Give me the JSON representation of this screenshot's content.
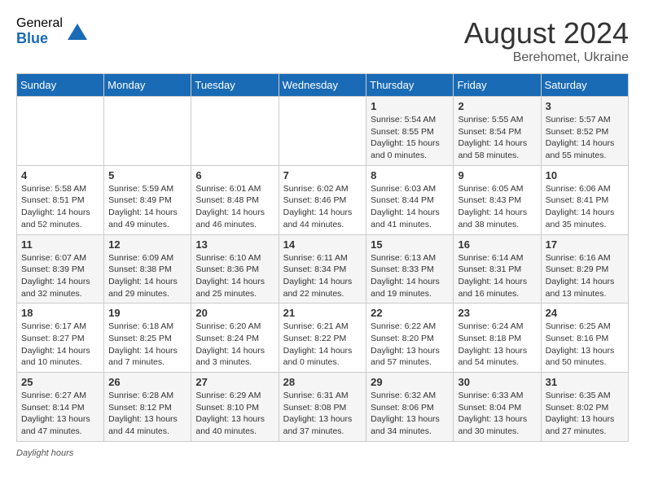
{
  "logo": {
    "general": "General",
    "blue": "Blue"
  },
  "header": {
    "month_year": "August 2024",
    "location": "Berehomet, Ukraine"
  },
  "weekdays": [
    "Sunday",
    "Monday",
    "Tuesday",
    "Wednesday",
    "Thursday",
    "Friday",
    "Saturday"
  ],
  "weeks": [
    [
      {
        "day": "",
        "info": ""
      },
      {
        "day": "",
        "info": ""
      },
      {
        "day": "",
        "info": ""
      },
      {
        "day": "",
        "info": ""
      },
      {
        "day": "1",
        "info": "Sunrise: 5:54 AM\nSunset: 8:55 PM\nDaylight: 15 hours\nand 0 minutes."
      },
      {
        "day": "2",
        "info": "Sunrise: 5:55 AM\nSunset: 8:54 PM\nDaylight: 14 hours\nand 58 minutes."
      },
      {
        "day": "3",
        "info": "Sunrise: 5:57 AM\nSunset: 8:52 PM\nDaylight: 14 hours\nand 55 minutes."
      }
    ],
    [
      {
        "day": "4",
        "info": "Sunrise: 5:58 AM\nSunset: 8:51 PM\nDaylight: 14 hours\nand 52 minutes."
      },
      {
        "day": "5",
        "info": "Sunrise: 5:59 AM\nSunset: 8:49 PM\nDaylight: 14 hours\nand 49 minutes."
      },
      {
        "day": "6",
        "info": "Sunrise: 6:01 AM\nSunset: 8:48 PM\nDaylight: 14 hours\nand 46 minutes."
      },
      {
        "day": "7",
        "info": "Sunrise: 6:02 AM\nSunset: 8:46 PM\nDaylight: 14 hours\nand 44 minutes."
      },
      {
        "day": "8",
        "info": "Sunrise: 6:03 AM\nSunset: 8:44 PM\nDaylight: 14 hours\nand 41 minutes."
      },
      {
        "day": "9",
        "info": "Sunrise: 6:05 AM\nSunset: 8:43 PM\nDaylight: 14 hours\nand 38 minutes."
      },
      {
        "day": "10",
        "info": "Sunrise: 6:06 AM\nSunset: 8:41 PM\nDaylight: 14 hours\nand 35 minutes."
      }
    ],
    [
      {
        "day": "11",
        "info": "Sunrise: 6:07 AM\nSunset: 8:39 PM\nDaylight: 14 hours\nand 32 minutes."
      },
      {
        "day": "12",
        "info": "Sunrise: 6:09 AM\nSunset: 8:38 PM\nDaylight: 14 hours\nand 29 minutes."
      },
      {
        "day": "13",
        "info": "Sunrise: 6:10 AM\nSunset: 8:36 PM\nDaylight: 14 hours\nand 25 minutes."
      },
      {
        "day": "14",
        "info": "Sunrise: 6:11 AM\nSunset: 8:34 PM\nDaylight: 14 hours\nand 22 minutes."
      },
      {
        "day": "15",
        "info": "Sunrise: 6:13 AM\nSunset: 8:33 PM\nDaylight: 14 hours\nand 19 minutes."
      },
      {
        "day": "16",
        "info": "Sunrise: 6:14 AM\nSunset: 8:31 PM\nDaylight: 14 hours\nand 16 minutes."
      },
      {
        "day": "17",
        "info": "Sunrise: 6:16 AM\nSunset: 8:29 PM\nDaylight: 14 hours\nand 13 minutes."
      }
    ],
    [
      {
        "day": "18",
        "info": "Sunrise: 6:17 AM\nSunset: 8:27 PM\nDaylight: 14 hours\nand 10 minutes."
      },
      {
        "day": "19",
        "info": "Sunrise: 6:18 AM\nSunset: 8:25 PM\nDaylight: 14 hours\nand 7 minutes."
      },
      {
        "day": "20",
        "info": "Sunrise: 6:20 AM\nSunset: 8:24 PM\nDaylight: 14 hours\nand 3 minutes."
      },
      {
        "day": "21",
        "info": "Sunrise: 6:21 AM\nSunset: 8:22 PM\nDaylight: 14 hours\nand 0 minutes."
      },
      {
        "day": "22",
        "info": "Sunrise: 6:22 AM\nSunset: 8:20 PM\nDaylight: 13 hours\nand 57 minutes."
      },
      {
        "day": "23",
        "info": "Sunrise: 6:24 AM\nSunset: 8:18 PM\nDaylight: 13 hours\nand 54 minutes."
      },
      {
        "day": "24",
        "info": "Sunrise: 6:25 AM\nSunset: 8:16 PM\nDaylight: 13 hours\nand 50 minutes."
      }
    ],
    [
      {
        "day": "25",
        "info": "Sunrise: 6:27 AM\nSunset: 8:14 PM\nDaylight: 13 hours\nand 47 minutes."
      },
      {
        "day": "26",
        "info": "Sunrise: 6:28 AM\nSunset: 8:12 PM\nDaylight: 13 hours\nand 44 minutes."
      },
      {
        "day": "27",
        "info": "Sunrise: 6:29 AM\nSunset: 8:10 PM\nDaylight: 13 hours\nand 40 minutes."
      },
      {
        "day": "28",
        "info": "Sunrise: 6:31 AM\nSunset: 8:08 PM\nDaylight: 13 hours\nand 37 minutes."
      },
      {
        "day": "29",
        "info": "Sunrise: 6:32 AM\nSunset: 8:06 PM\nDaylight: 13 hours\nand 34 minutes."
      },
      {
        "day": "30",
        "info": "Sunrise: 6:33 AM\nSunset: 8:04 PM\nDaylight: 13 hours\nand 30 minutes."
      },
      {
        "day": "31",
        "info": "Sunrise: 6:35 AM\nSunset: 8:02 PM\nDaylight: 13 hours\nand 27 minutes."
      }
    ]
  ],
  "footer": {
    "daylight_label": "Daylight hours"
  }
}
